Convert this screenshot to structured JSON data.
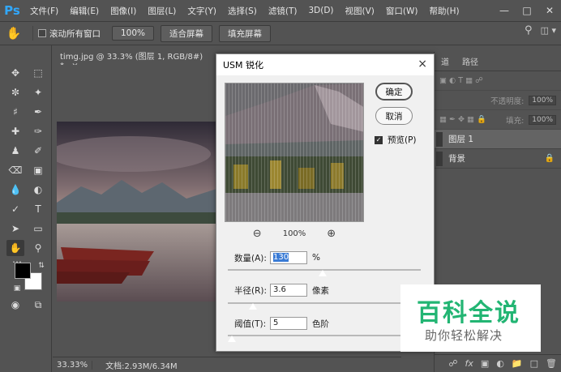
{
  "app": {
    "logo": "Ps"
  },
  "menu": [
    "文件(F)",
    "编辑(E)",
    "图像(I)",
    "图层(L)",
    "文字(Y)",
    "选择(S)",
    "滤镜(T)",
    "3D(D)",
    "视图(V)",
    "窗口(W)",
    "帮助(H)"
  ],
  "options": {
    "scroll_all_windows_label": "滚动所有窗口",
    "zoom_value": "100%",
    "fit_screen_label": "适合屏幕",
    "fill_screen_label": "填充屏幕"
  },
  "document": {
    "tab_title": "timg.jpg @ 33.3% (图层 1, RGB/8#) *",
    "tab_close": "×",
    "status_zoom": "33.33%",
    "status_doc": "文档:2.93M/6.34M"
  },
  "panel": {
    "tabs": [
      "道",
      "路径"
    ],
    "opacity_label": "不透明度:",
    "opacity_value": "100%",
    "fill_label": "填充:",
    "fill_value": "100%",
    "layers": [
      {
        "name": "图层 1",
        "selected": true
      },
      {
        "name": "背景",
        "selected": false,
        "locked": true
      }
    ]
  },
  "dialog": {
    "title": "USM 锐化",
    "close": "×",
    "ok_label": "确定",
    "cancel_label": "取消",
    "preview_label": "预览(P)",
    "preview_checked": true,
    "preview_zoom": "100%",
    "amount_label": "数量(A):",
    "amount_value": "130",
    "amount_unit": "%",
    "amount_level": 0.49,
    "radius_label": "半径(R):",
    "radius_value": "3.6",
    "radius_unit": "像素",
    "radius_level": 0.13,
    "threshold_label": "阈值(T):",
    "threshold_value": "5",
    "threshold_unit": "色阶",
    "threshold_level": 0.02
  },
  "watermark": {
    "title": "百科全说",
    "subtitle": "助你轻松解决",
    "color": "#22b573"
  }
}
